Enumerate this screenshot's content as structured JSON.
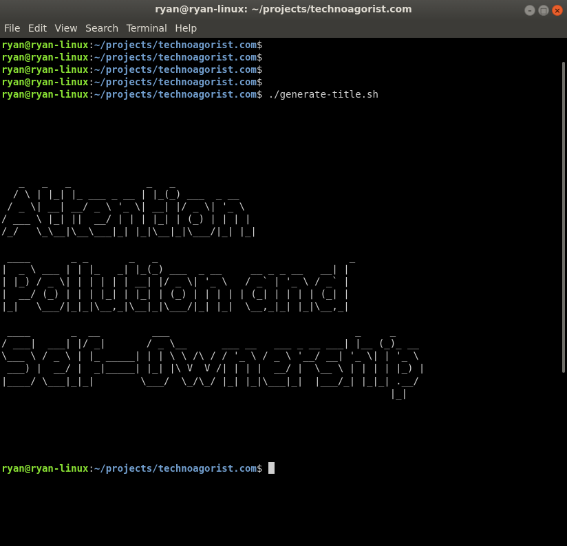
{
  "window": {
    "title": "ryan@ryan-linux: ~/projects/technoagorist.com"
  },
  "menu": {
    "items": [
      "File",
      "Edit",
      "View",
      "Search",
      "Terminal",
      "Help"
    ]
  },
  "prompt": {
    "user_host": "ryan@ryan-linux",
    "separator": ":",
    "path": "~/projects/technoagorist.com",
    "symbol": "$"
  },
  "command": " ./generate-title.sh",
  "banner": [
    "   _   _   _             _   _",
    "  / \\ | |_| |_ ___ _ __ | |_(_) ___  _ __",
    " / _ \\| __| __/ _ \\ '_ \\| __| |/ _ \\| '_ \\",
    "/ ___ \\ |_| ||  __/ | | | |_| | (_) | | | |",
    "/_/   \\_\\__|\\__\\___|_| |_|\\__|_|\\___/|_| |_|",
    "",
    " ____       _ _       _   _                                 _",
    "|  _ \\ ___ | | |_   _| |_(_) ___  _ __     __ _ _ __   __| |",
    "| |_) / _ \\| | | | | | __| |/ _ \\| '_ \\   / _` | '_ \\ / _` |",
    "|  __/ (_) | | | |_| | |_| | (_) | | | | | (_| | | | | (_| |",
    "|_|   \\___/|_|_|\\__,_|\\__|_|\\___/|_| |_|  \\__,_|_| |_|\\__,_|",
    "",
    " ____       _  __         ___                                _     _",
    "/ ___|  ___| |/ _|       / _ \\__      ___ __   ___ _ __ ___| |__ (_)_ __",
    "\\___ \\ / _ \\ | |_ _____| | | \\ \\ /\\ / / '_ \\ / _ \\ '__/ __| '_ \\| | '_ \\",
    " ___) |  __/ |  _|_____| |_| |\\ V  V /| | | |  __/ |  \\__ \\ | | | | |_) |",
    "|____/ \\___|_|_|        \\___/  \\_/\\_/ |_| |_|\\___|_|  |___/_| |_|_| .__/",
    "                                                                   |_|"
  ]
}
